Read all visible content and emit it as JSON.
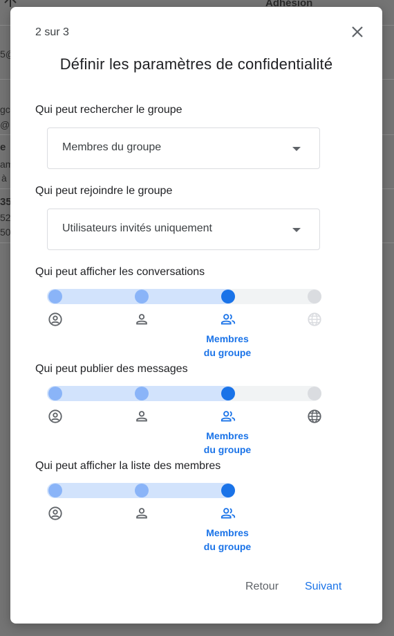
{
  "background": {
    "fragments": [
      "Adhésion",
      "5@",
      "gc",
      "@",
      "e",
      "am",
      "à",
      "35",
      "52",
      "50"
    ]
  },
  "dialog": {
    "step": "2 sur 3",
    "title": "Définir les paramètres de confidentialité",
    "close_icon": "close-icon",
    "search": {
      "label": "Qui peut rechercher le groupe",
      "value": "Membres du groupe"
    },
    "join": {
      "label": "Qui peut rejoindre le groupe",
      "value": "Utilisateurs invités uniquement"
    },
    "view_conversations": {
      "label": "Qui peut afficher les conversations",
      "options": [
        "owner-icon",
        "person-icon",
        "group-icon",
        "globe-icon"
      ],
      "selected_index": 2,
      "selected_label_line1": "Membres",
      "selected_label_line2": "du groupe",
      "last_option_disabled": true
    },
    "post_messages": {
      "label": "Qui peut publier des messages",
      "options": [
        "owner-icon",
        "person-icon",
        "group-icon",
        "globe-icon"
      ],
      "selected_index": 2,
      "selected_label_line1": "Membres",
      "selected_label_line2": "du groupe",
      "last_option_disabled": false
    },
    "view_members": {
      "label": "Qui peut afficher la liste des membres",
      "options": [
        "owner-icon",
        "person-icon",
        "group-icon"
      ],
      "selected_index": 2,
      "selected_label_line1": "Membres",
      "selected_label_line2": "du groupe"
    },
    "buttons": {
      "back": "Retour",
      "next": "Suivant"
    }
  },
  "colors": {
    "accent": "#1a73e8",
    "accent_light": "#8ab4f8",
    "track_fill": "#d2e3fc",
    "disabled": "#dadce0"
  }
}
